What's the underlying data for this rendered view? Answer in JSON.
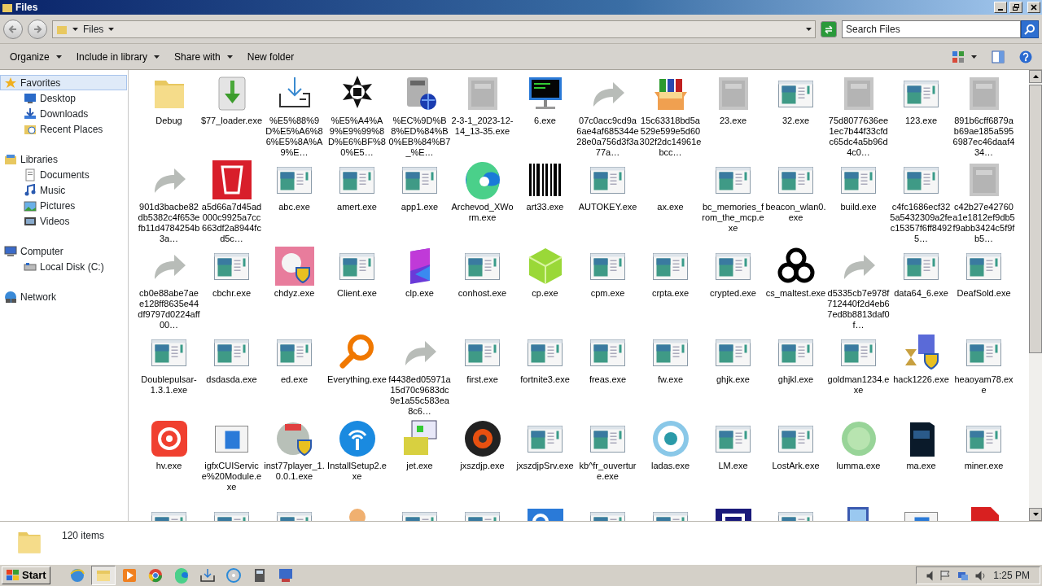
{
  "window": {
    "title": "Files"
  },
  "address": {
    "path": "Files"
  },
  "search": {
    "placeholder": "Search Files"
  },
  "toolbar": {
    "buttons": [
      {
        "label": "Organize",
        "dropdown": true
      },
      {
        "label": "Include in library",
        "dropdown": true
      },
      {
        "label": "Share with",
        "dropdown": true
      },
      {
        "label": "New folder",
        "dropdown": false
      }
    ]
  },
  "sidebar": {
    "groups": [
      {
        "label": "Favorites",
        "selected": true,
        "children": [
          {
            "label": "Desktop",
            "selected": false
          },
          {
            "label": "Downloads",
            "selected": false
          },
          {
            "label": "Recent Places",
            "selected": false
          }
        ]
      },
      {
        "label": "Libraries",
        "selected": false,
        "children": [
          {
            "label": "Documents",
            "selected": false
          },
          {
            "label": "Music",
            "selected": false
          },
          {
            "label": "Pictures",
            "selected": false
          },
          {
            "label": "Videos",
            "selected": false
          }
        ]
      },
      {
        "label": "Computer",
        "selected": false,
        "children": [
          {
            "label": "Local Disk (C:)",
            "selected": false
          }
        ]
      },
      {
        "label": "Network",
        "selected": false
      }
    ]
  },
  "files": [
    {
      "name": "Debug",
      "kind": "folder"
    },
    {
      "name": "$77_loader.exe",
      "kind": "download"
    },
    {
      "name": "%E5%88%9D%E5%A6%86%E5%8A%A9%E…",
      "kind": "tray"
    },
    {
      "name": "%E5%A4%A9%E9%99%8D%E6%BF%80%E5…",
      "kind": "star"
    },
    {
      "name": "%EC%9D%B8%ED%84%B0%EB%84%B7_%E…",
      "kind": "server"
    },
    {
      "name": "2-3-1_2023-12-14_13-35.exe",
      "kind": "blurred"
    },
    {
      "name": "6.exe",
      "kind": "console"
    },
    {
      "name": "07c0acc9cd9a6ae4af685344e28e0a756d3f3a77a…",
      "kind": "shortcut"
    },
    {
      "name": "15c63318bd5a529e599e5d60302f2dc14961ebcc…",
      "kind": "archive"
    },
    {
      "name": "23.exe",
      "kind": "blurred"
    },
    {
      "name": "32.exe",
      "kind": "app"
    },
    {
      "name": "75d8077636ee1ec7b44f33cfdc65dc4a5b96d4c0…",
      "kind": "blurred"
    },
    {
      "name": "123.exe",
      "kind": "app"
    },
    {
      "name": "891b6cff6879ab69ae185a5956987ec46daaf434…",
      "kind": "blurred"
    },
    {
      "name": "901d3bacbe82db5382c4f653efb11d4784254b3a…",
      "kind": "shortcut"
    },
    {
      "name": "a5d66a7d45ad000c9925a7cc663df2a8944fcd5c…",
      "kind": "redbin"
    },
    {
      "name": "abc.exe",
      "kind": "app"
    },
    {
      "name": "amert.exe",
      "kind": "app"
    },
    {
      "name": "app1.exe",
      "kind": "app"
    },
    {
      "name": "Archevod_XWorm.exe",
      "kind": "swirl"
    },
    {
      "name": "art33.exe",
      "kind": "barcode"
    },
    {
      "name": "AUTOKEY.exe",
      "kind": "app"
    },
    {
      "name": "ax.exe",
      "kind": "none"
    },
    {
      "name": "bc_memories_from_the_mcp.exe",
      "kind": "app"
    },
    {
      "name": "beacon_wlan0.exe",
      "kind": "app"
    },
    {
      "name": "build.exe",
      "kind": "app"
    },
    {
      "name": "c4fc1686ecf325a5432309a2fec15357f6ff84925…",
      "kind": "app"
    },
    {
      "name": "c42b27e42760a1e1812ef9db5f9abb3424c5f9fb5…",
      "kind": "blurred"
    },
    {
      "name": "cb0e88abe7aee128ff8635e44df9797d0224aff00…",
      "kind": "shortcut"
    },
    {
      "name": "cbchr.exe",
      "kind": "app"
    },
    {
      "name": "chdyz.exe",
      "kind": "pinkshield"
    },
    {
      "name": "Client.exe",
      "kind": "app"
    },
    {
      "name": "clp.exe",
      "kind": "crystal"
    },
    {
      "name": "conhost.exe",
      "kind": "app"
    },
    {
      "name": "cp.exe",
      "kind": "cube"
    },
    {
      "name": "cpm.exe",
      "kind": "app"
    },
    {
      "name": "crpta.exe",
      "kind": "app"
    },
    {
      "name": "crypted.exe",
      "kind": "app"
    },
    {
      "name": "cs_maltest.exe",
      "kind": "biohazard"
    },
    {
      "name": "d5335cb7e978f712440f2d4eb67ed8b8813daf0f…",
      "kind": "shortcut"
    },
    {
      "name": "data64_6.exe",
      "kind": "app"
    },
    {
      "name": "DeafSold.exe",
      "kind": "app"
    },
    {
      "name": "Doublepulsar-1.3.1.exe",
      "kind": "app"
    },
    {
      "name": "dsdasda.exe",
      "kind": "app"
    },
    {
      "name": "ed.exe",
      "kind": "app"
    },
    {
      "name": "Everything.exe",
      "kind": "magnifier"
    },
    {
      "name": "f4438ed05971a15d70c9683dc9e1a55c583ea8c6…",
      "kind": "shortcut"
    },
    {
      "name": "first.exe",
      "kind": "app"
    },
    {
      "name": "fortnite3.exe",
      "kind": "app"
    },
    {
      "name": "freas.exe",
      "kind": "app"
    },
    {
      "name": "fw.exe",
      "kind": "app"
    },
    {
      "name": "ghjk.exe",
      "kind": "app"
    },
    {
      "name": "ghjkl.exe",
      "kind": "app"
    },
    {
      "name": "goldman1234.exe",
      "kind": "app"
    },
    {
      "name": "hack1226.exe",
      "kind": "hourglass"
    },
    {
      "name": "heaoyam78.exe",
      "kind": "app"
    },
    {
      "name": "hv.exe",
      "kind": "record"
    },
    {
      "name": "igfxCUIService%20Module.exe",
      "kind": "window"
    },
    {
      "name": "inst77player_1.0.0.1.exe",
      "kind": "installer"
    },
    {
      "name": "InstallSetup2.exe",
      "kind": "wireless"
    },
    {
      "name": "jet.exe",
      "kind": "package"
    },
    {
      "name": "jxszdjp.exe",
      "kind": "disc"
    },
    {
      "name": "jxszdjpSrv.exe",
      "kind": "app"
    },
    {
      "name": "kb^fr_ouverture.exe",
      "kind": "app"
    },
    {
      "name": "ladas.exe",
      "kind": "eye"
    },
    {
      "name": "LM.exe",
      "kind": "app"
    },
    {
      "name": "LostArk.exe",
      "kind": "app"
    },
    {
      "name": "lumma.exe",
      "kind": "orb"
    },
    {
      "name": "ma.exe",
      "kind": "darkbox"
    },
    {
      "name": "miner.exe",
      "kind": "app"
    },
    {
      "kind": "app"
    },
    {
      "kind": "app"
    },
    {
      "kind": "app"
    },
    {
      "kind": "person"
    },
    {
      "kind": "app"
    },
    {
      "kind": "app"
    },
    {
      "kind": "gearwindow"
    },
    {
      "kind": "app"
    },
    {
      "kind": "app"
    },
    {
      "kind": "bluecube"
    },
    {
      "kind": "app"
    },
    {
      "kind": "computer"
    },
    {
      "kind": "window"
    },
    {
      "kind": "document"
    }
  ],
  "details": {
    "count": "120 items"
  },
  "taskbar": {
    "start": "Start",
    "apps": [
      {
        "kind": "browser",
        "active": false
      },
      {
        "kind": "explorer",
        "active": true
      },
      {
        "kind": "media",
        "active": false
      },
      {
        "kind": "chrome",
        "active": false
      },
      {
        "kind": "swirl",
        "active": false
      },
      {
        "kind": "tray",
        "active": false
      },
      {
        "kind": "disc",
        "active": false
      },
      {
        "kind": "calc",
        "active": false
      },
      {
        "kind": "netapp",
        "active": false
      }
    ],
    "clock": "1:25 PM"
  }
}
